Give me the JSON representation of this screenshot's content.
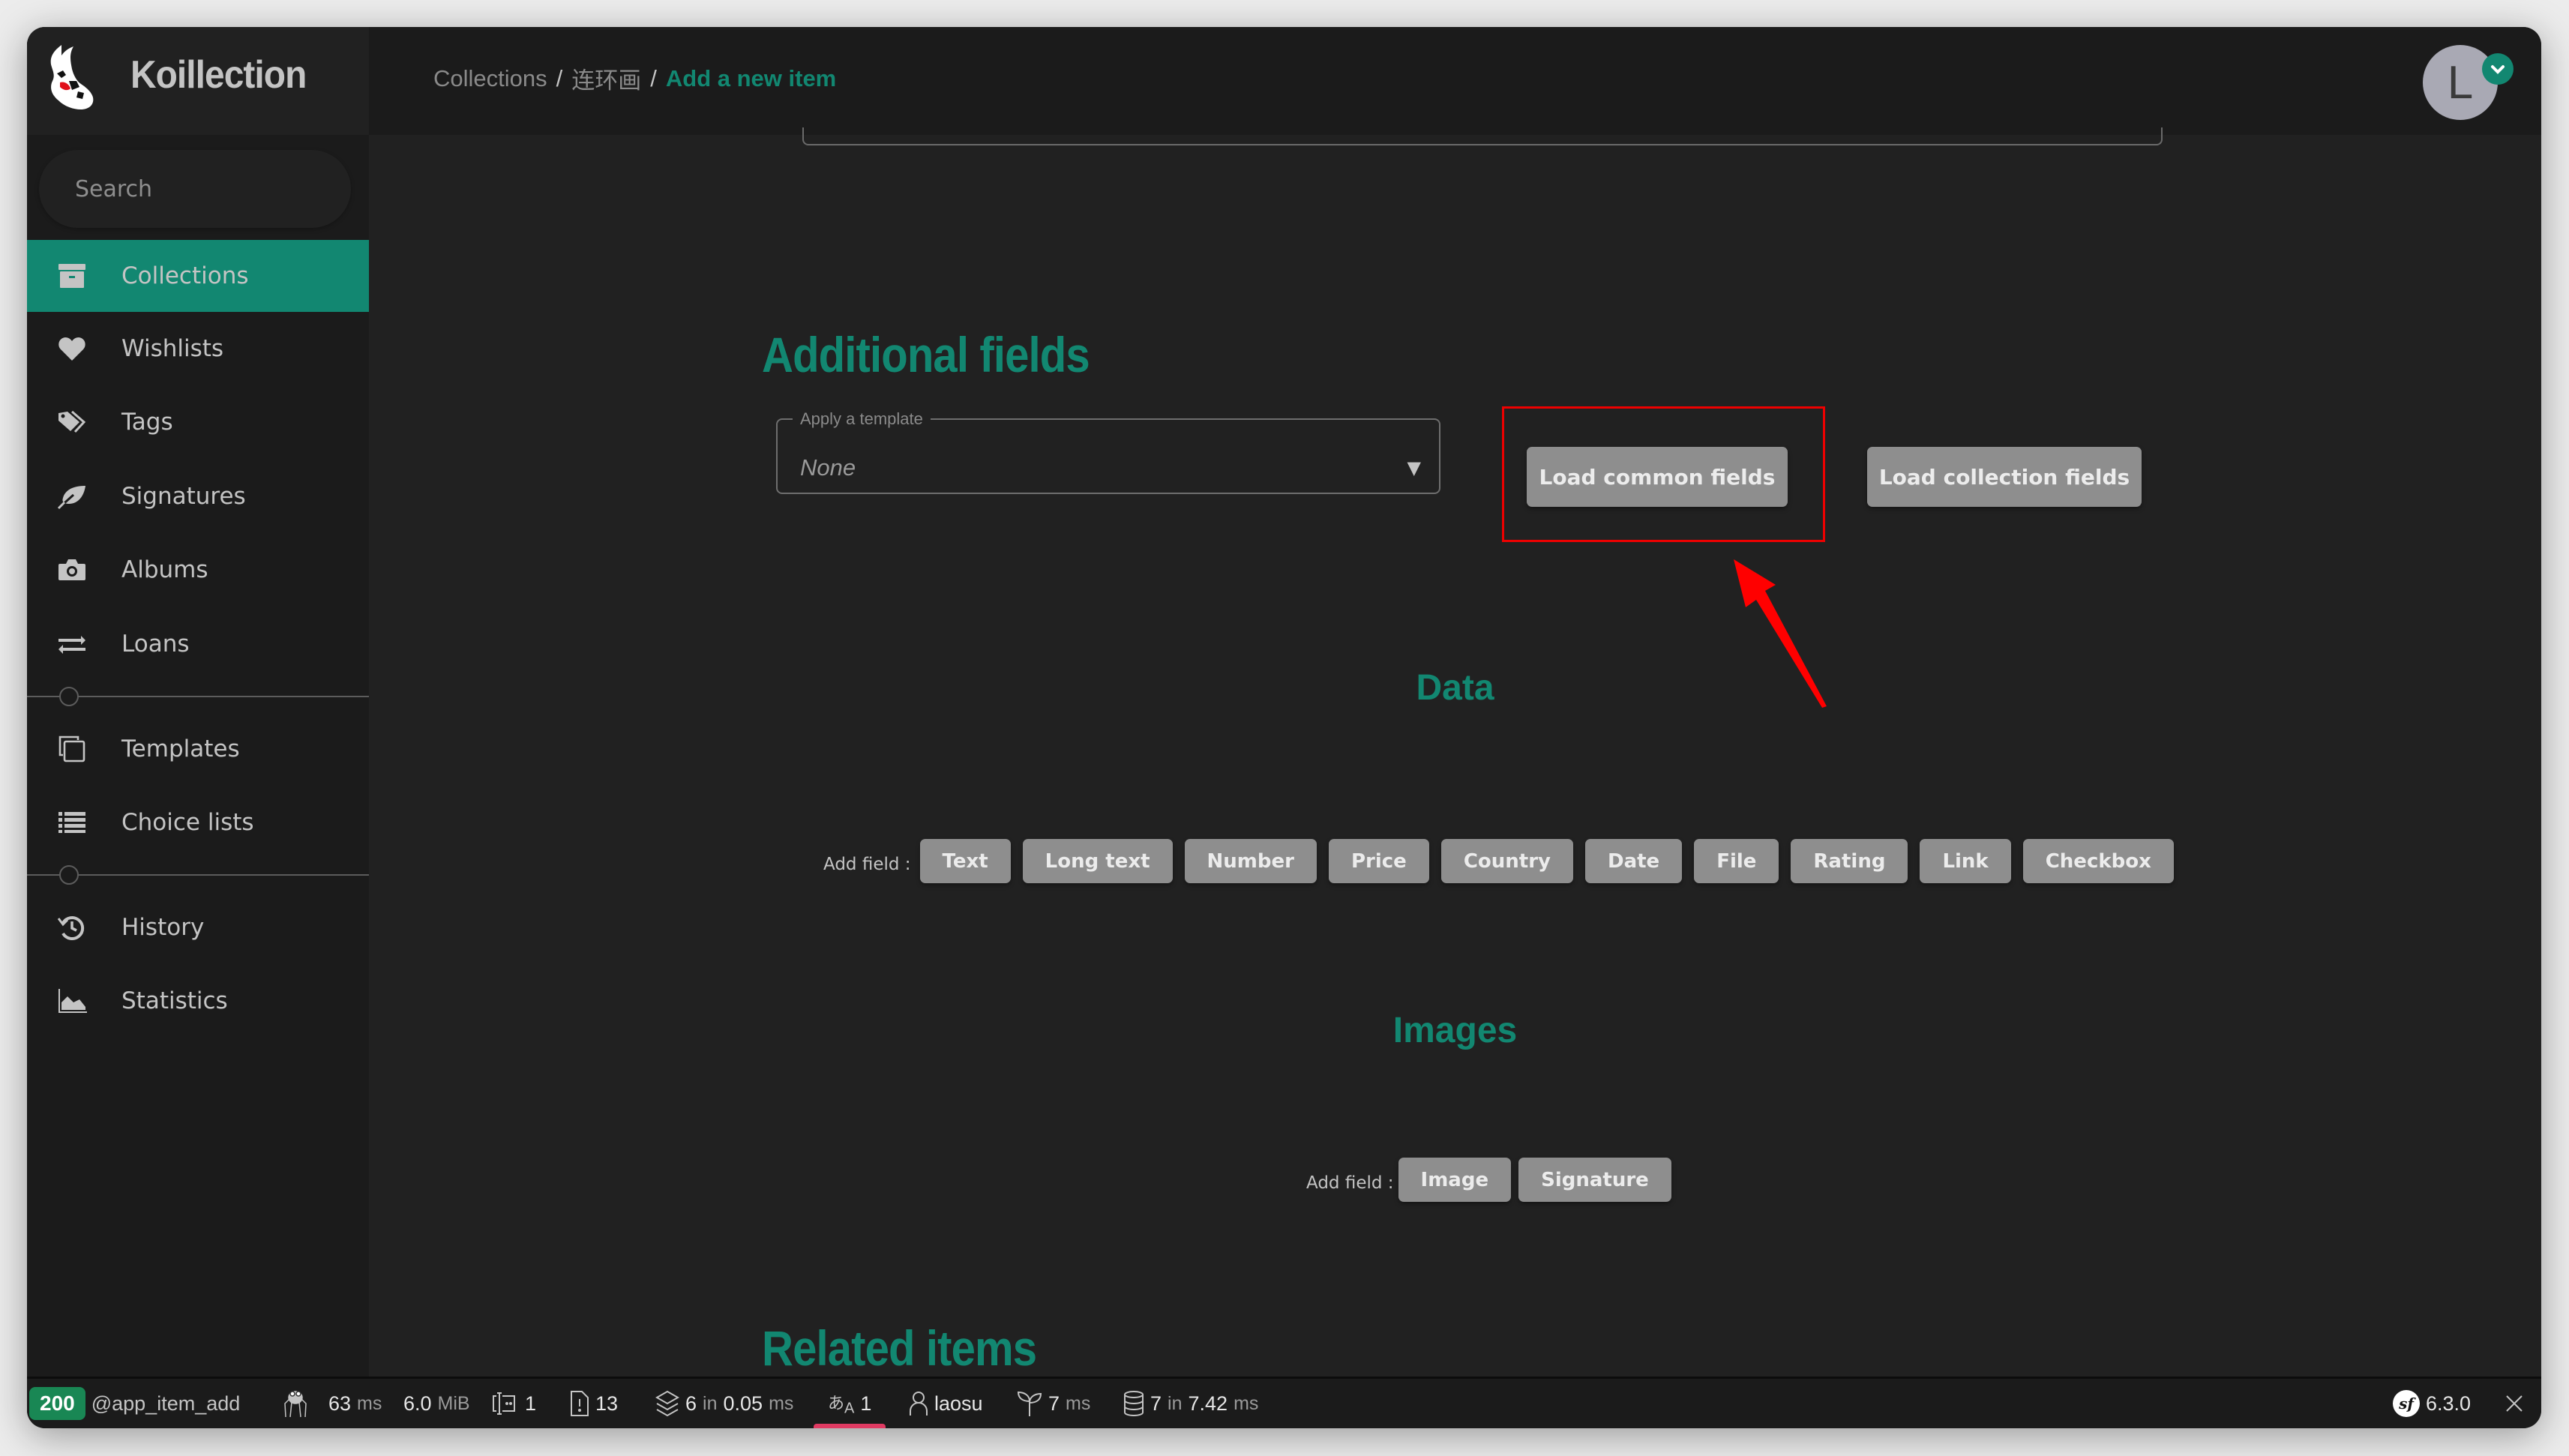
{
  "app": {
    "name": "Koillection",
    "logo_icon": "koi-fish-logo"
  },
  "header": {
    "breadcrumb": [
      {
        "label": "Collections"
      },
      {
        "label": "连环画"
      },
      {
        "label": "Add a new item"
      }
    ],
    "separator": "/",
    "avatar_initial": "L"
  },
  "sidebar": {
    "search_placeholder": "Search",
    "items": [
      {
        "label": "Collections",
        "icon": "archive-box-icon",
        "active": true
      },
      {
        "label": "Wishlists",
        "icon": "heart-icon"
      },
      {
        "label": "Tags",
        "icon": "tags-icon"
      },
      {
        "label": "Signatures",
        "icon": "feather-icon"
      },
      {
        "label": "Albums",
        "icon": "camera-icon"
      },
      {
        "label": "Loans",
        "icon": "exchange-arrows-icon"
      },
      {
        "label": "Templates",
        "icon": "copy-icon"
      },
      {
        "label": "Choice lists",
        "icon": "list-icon"
      },
      {
        "label": "History",
        "icon": "history-icon"
      },
      {
        "label": "Statistics",
        "icon": "area-chart-icon"
      }
    ]
  },
  "main": {
    "additional_fields_title": "Additional fields",
    "template_select": {
      "legend": "Apply a template",
      "value": "None"
    },
    "load_common_fields": "Load common fields",
    "load_collection_fields": "Load collection fields",
    "data_section": {
      "title": "Data",
      "add_field_label": "Add field :",
      "buttons": [
        "Text",
        "Long text",
        "Number",
        "Price",
        "Country",
        "Date",
        "File",
        "Rating",
        "Link",
        "Checkbox"
      ]
    },
    "images_section": {
      "title": "Images",
      "add_field_label": "Add field :",
      "buttons": [
        "Image",
        "Signature"
      ]
    },
    "related_items_title": "Related items"
  },
  "annotation": {
    "highlight_color": "#ee0000",
    "target": "Load common fields"
  },
  "statusbar": {
    "status_code": "200",
    "route": "@app_item_add",
    "time_value": "63",
    "time_unit": "ms",
    "memory_value": "6.0",
    "memory_unit": "MiB",
    "forms_count": "1",
    "logs_count": "13",
    "cache_value": "6",
    "cache_in": "in",
    "cache_time": "0.05",
    "cache_unit": "ms",
    "translation_count": "1",
    "user": "laosu",
    "twig_value": "7",
    "twig_unit": "ms",
    "db_value": "7",
    "db_in": "in",
    "db_time": "7.42",
    "db_unit": "ms",
    "symfony_version": "6.3.0"
  },
  "colors": {
    "accent": "#128771",
    "sidebar_bg": "#1b1b1b",
    "content_bg": "#212121",
    "button_bg": "#8e8e8e",
    "status_ok": "#198754",
    "toolbar_highlight": "#e03a62"
  }
}
